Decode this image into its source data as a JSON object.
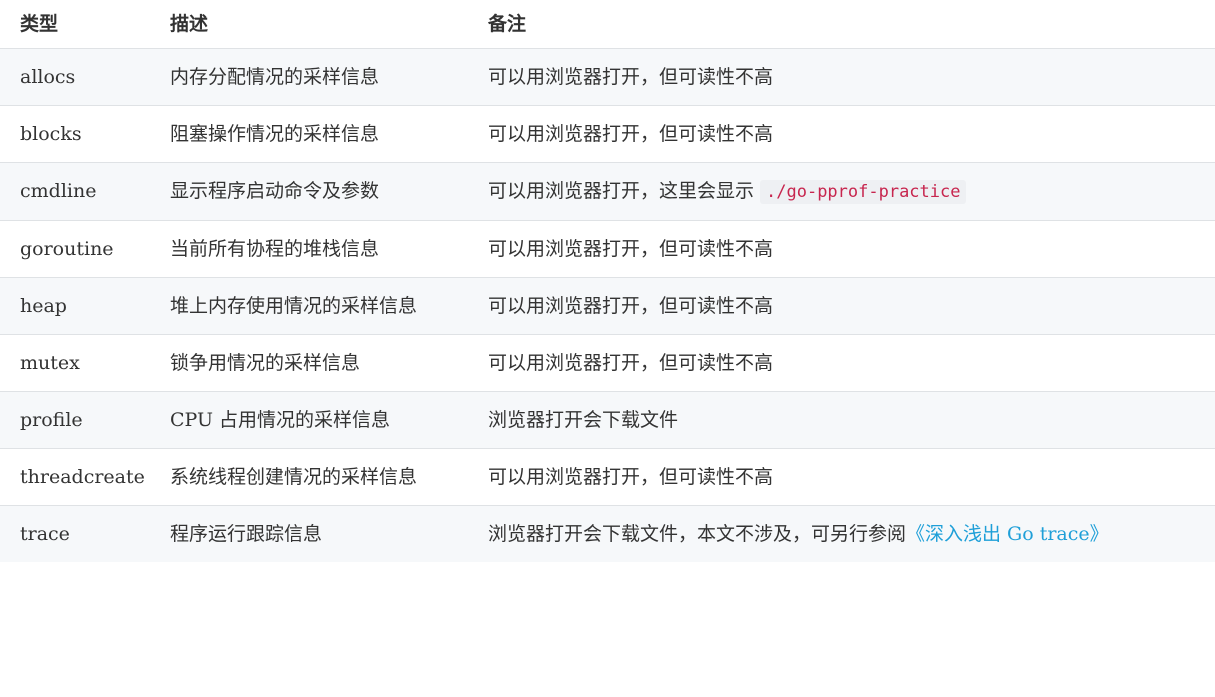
{
  "table": {
    "headers": [
      "类型",
      "描述",
      "备注"
    ],
    "rows": [
      {
        "type": "allocs",
        "desc": "内存分配情况的采样信息",
        "note": "可以用浏览器打开，但可读性不高"
      },
      {
        "type": "blocks",
        "desc": "阻塞操作情况的采样信息",
        "note": "可以用浏览器打开，但可读性不高"
      },
      {
        "type": "cmdline",
        "desc": "显示程序启动命令及参数",
        "note": "可以用浏览器打开，这里会显示",
        "note_code": "./go-pprof-practice"
      },
      {
        "type": "goroutine",
        "desc": "当前所有协程的堆栈信息",
        "note": "可以用浏览器打开，但可读性不高"
      },
      {
        "type": "heap",
        "desc": "堆上内存使用情况的采样信息",
        "note": "可以用浏览器打开，但可读性不高"
      },
      {
        "type": "mutex",
        "desc": "锁争用情况的采样信息",
        "note": "可以用浏览器打开，但可读性不高"
      },
      {
        "type": "profile",
        "desc": "CPU 占用情况的采样信息",
        "note": "浏览器打开会下载文件"
      },
      {
        "type": "threadcreate",
        "desc": "系统线程创建情况的采样信息",
        "note": "可以用浏览器打开，但可读性不高"
      },
      {
        "type": "trace",
        "desc": "程序运行跟踪信息",
        "note": "浏览器打开会下载文件，本文不涉及，可另行参阅",
        "note_link": "《深入浅出 Go trace》"
      }
    ]
  },
  "colors": {
    "link": "#1e9fd8",
    "code": "#c7254e",
    "stripe": "#f6f8fa"
  }
}
